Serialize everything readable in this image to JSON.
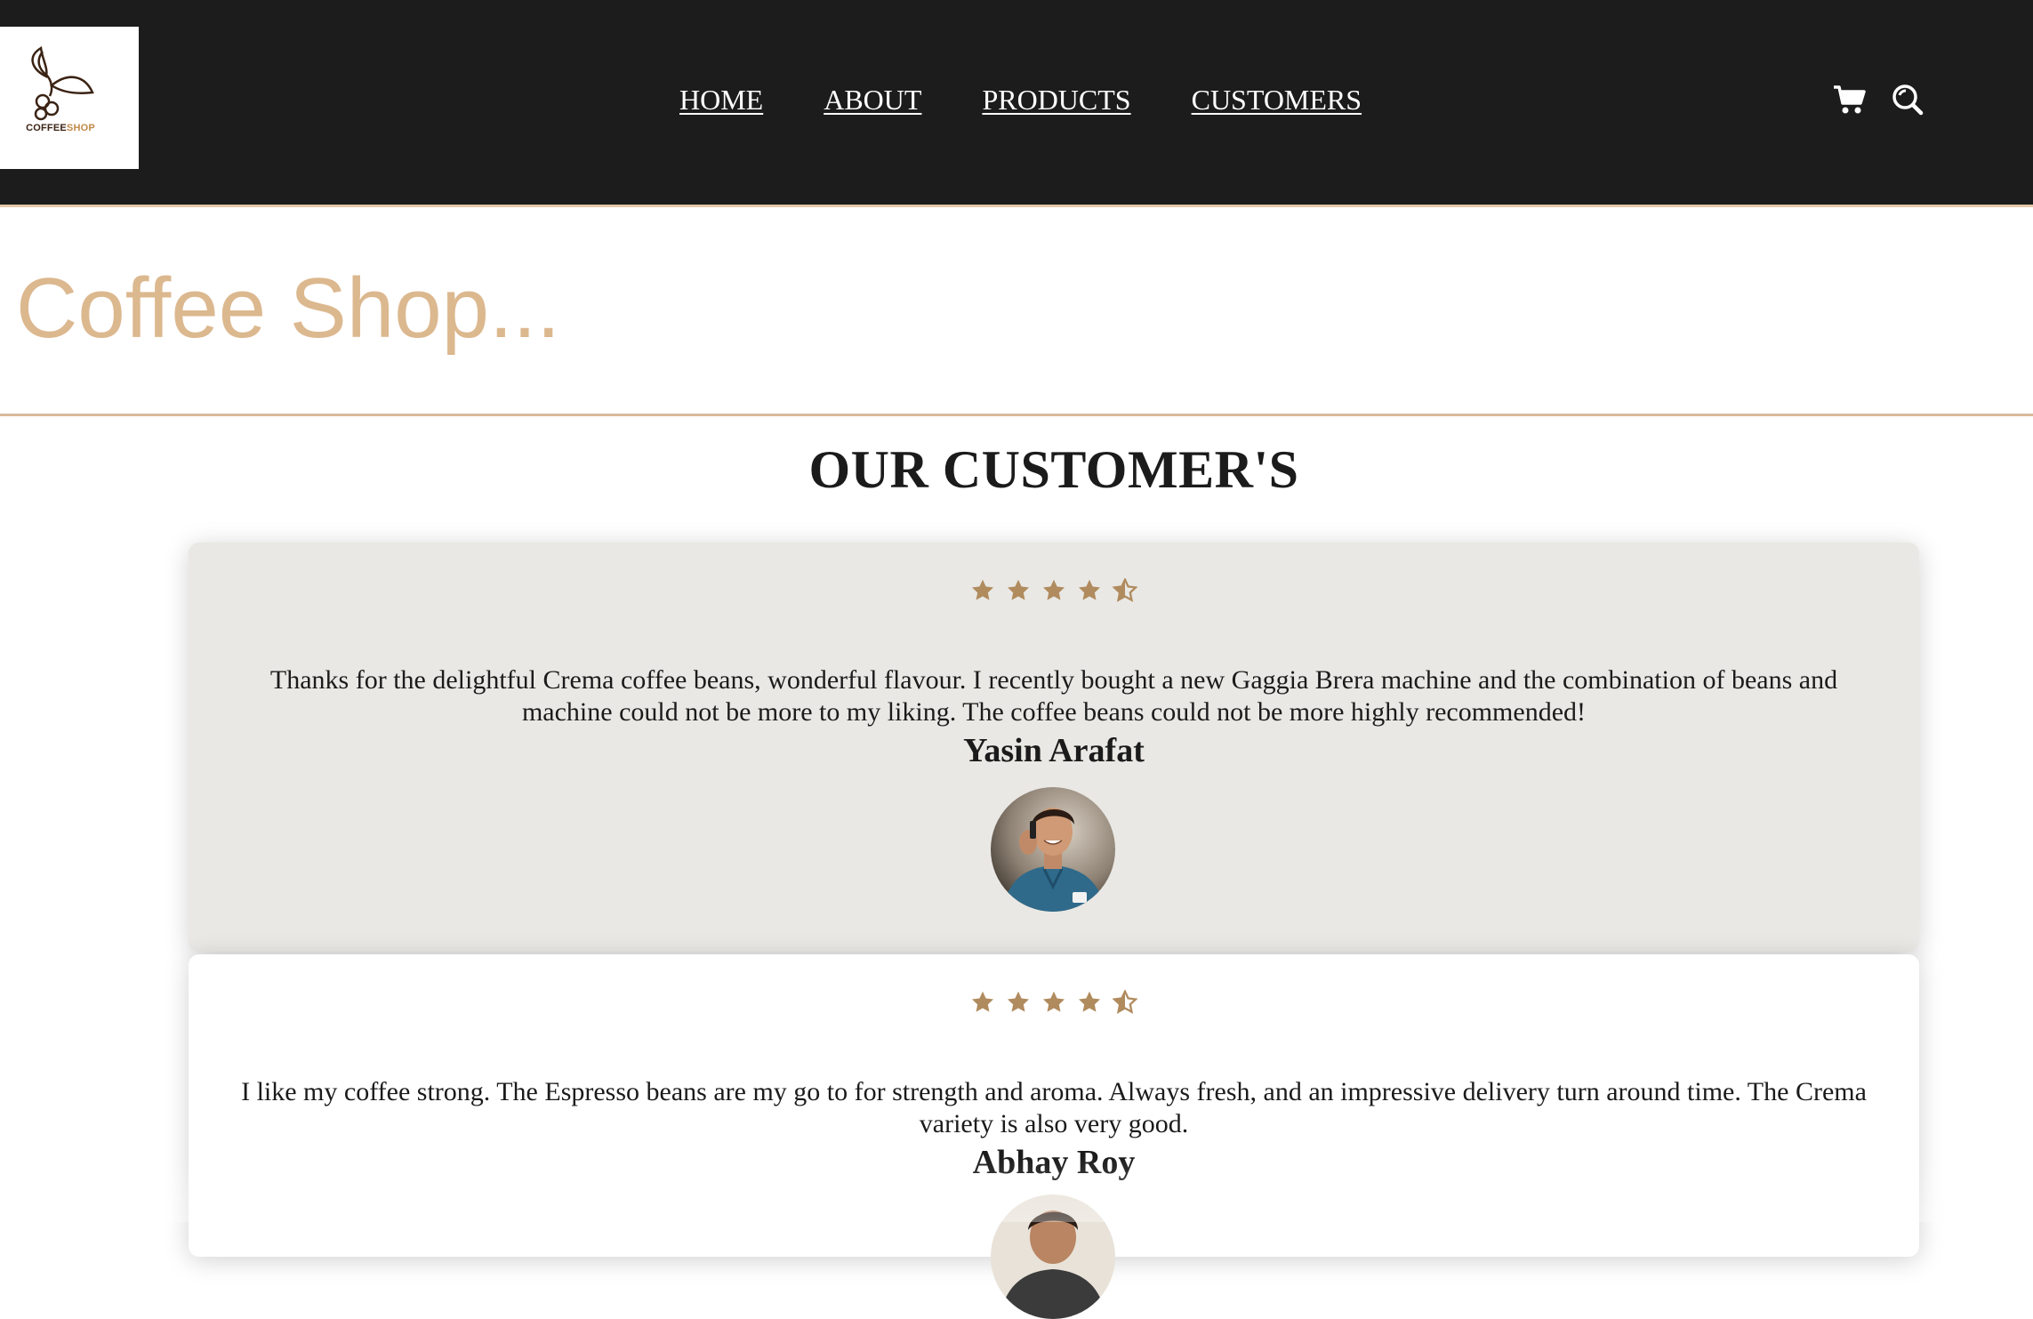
{
  "header": {
    "logo": {
      "brand_dark": "COFFEE",
      "brand_accent": "SHOP",
      "icon": "coffee-branch-logo-icon"
    },
    "nav": [
      {
        "label": "HOME"
      },
      {
        "label": "ABOUT"
      },
      {
        "label": "PRODUCTS"
      },
      {
        "label": "CUSTOMERS"
      }
    ],
    "icons": [
      "cart-icon",
      "search-icon"
    ]
  },
  "banner": {
    "title": "Coffee Shop..."
  },
  "customers": {
    "title": "OUR CUSTOMER'S",
    "reviews": [
      {
        "rating": 4.5,
        "text": "Thanks for the delightful Crema coffee beans, wonderful flavour. I recently bought a new Gaggia Brera machine and the combination of beans and machine could not be more to my liking. The coffee beans could not be more highly recommended!",
        "name": "Yasin Arafat",
        "avatar": "customer-photo"
      },
      {
        "rating": 4.5,
        "text": "I like my coffee strong. The Espresso beans are my go to for strength and aroma. Always fresh, and an impressive delivery turn around time. The Crema variety is also very good.",
        "name": "Abhay Roy",
        "avatar": "customer-photo"
      }
    ]
  },
  "colors": {
    "header_bg": "#1c1c1c",
    "accent_tan": "#dcb88f",
    "star": "#b08b5e",
    "card_grey": "#e9e8e4"
  }
}
